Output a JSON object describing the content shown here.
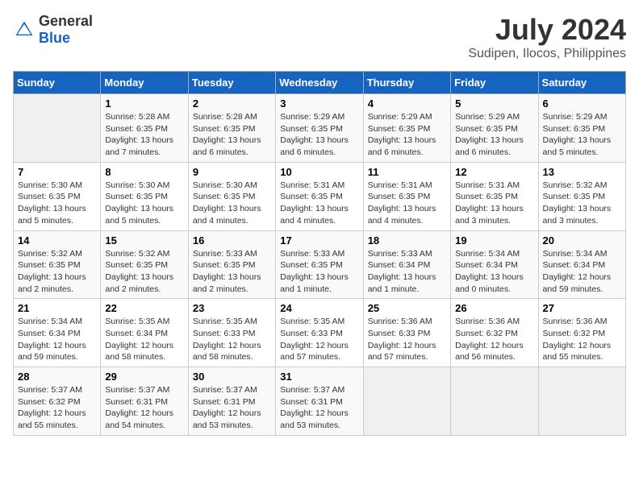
{
  "header": {
    "logo_general": "General",
    "logo_blue": "Blue",
    "title": "July 2024",
    "location": "Sudipen, Ilocos, Philippines"
  },
  "days_of_week": [
    "Sunday",
    "Monday",
    "Tuesday",
    "Wednesday",
    "Thursday",
    "Friday",
    "Saturday"
  ],
  "weeks": [
    [
      {
        "day": "",
        "info": ""
      },
      {
        "day": "1",
        "info": "Sunrise: 5:28 AM\nSunset: 6:35 PM\nDaylight: 13 hours\nand 7 minutes."
      },
      {
        "day": "2",
        "info": "Sunrise: 5:28 AM\nSunset: 6:35 PM\nDaylight: 13 hours\nand 6 minutes."
      },
      {
        "day": "3",
        "info": "Sunrise: 5:29 AM\nSunset: 6:35 PM\nDaylight: 13 hours\nand 6 minutes."
      },
      {
        "day": "4",
        "info": "Sunrise: 5:29 AM\nSunset: 6:35 PM\nDaylight: 13 hours\nand 6 minutes."
      },
      {
        "day": "5",
        "info": "Sunrise: 5:29 AM\nSunset: 6:35 PM\nDaylight: 13 hours\nand 6 minutes."
      },
      {
        "day": "6",
        "info": "Sunrise: 5:29 AM\nSunset: 6:35 PM\nDaylight: 13 hours\nand 5 minutes."
      }
    ],
    [
      {
        "day": "7",
        "info": "Sunrise: 5:30 AM\nSunset: 6:35 PM\nDaylight: 13 hours\nand 5 minutes."
      },
      {
        "day": "8",
        "info": "Sunrise: 5:30 AM\nSunset: 6:35 PM\nDaylight: 13 hours\nand 5 minutes."
      },
      {
        "day": "9",
        "info": "Sunrise: 5:30 AM\nSunset: 6:35 PM\nDaylight: 13 hours\nand 4 minutes."
      },
      {
        "day": "10",
        "info": "Sunrise: 5:31 AM\nSunset: 6:35 PM\nDaylight: 13 hours\nand 4 minutes."
      },
      {
        "day": "11",
        "info": "Sunrise: 5:31 AM\nSunset: 6:35 PM\nDaylight: 13 hours\nand 4 minutes."
      },
      {
        "day": "12",
        "info": "Sunrise: 5:31 AM\nSunset: 6:35 PM\nDaylight: 13 hours\nand 3 minutes."
      },
      {
        "day": "13",
        "info": "Sunrise: 5:32 AM\nSunset: 6:35 PM\nDaylight: 13 hours\nand 3 minutes."
      }
    ],
    [
      {
        "day": "14",
        "info": "Sunrise: 5:32 AM\nSunset: 6:35 PM\nDaylight: 13 hours\nand 2 minutes."
      },
      {
        "day": "15",
        "info": "Sunrise: 5:32 AM\nSunset: 6:35 PM\nDaylight: 13 hours\nand 2 minutes."
      },
      {
        "day": "16",
        "info": "Sunrise: 5:33 AM\nSunset: 6:35 PM\nDaylight: 13 hours\nand 2 minutes."
      },
      {
        "day": "17",
        "info": "Sunrise: 5:33 AM\nSunset: 6:35 PM\nDaylight: 13 hours\nand 1 minute."
      },
      {
        "day": "18",
        "info": "Sunrise: 5:33 AM\nSunset: 6:34 PM\nDaylight: 13 hours\nand 1 minute."
      },
      {
        "day": "19",
        "info": "Sunrise: 5:34 AM\nSunset: 6:34 PM\nDaylight: 13 hours\nand 0 minutes."
      },
      {
        "day": "20",
        "info": "Sunrise: 5:34 AM\nSunset: 6:34 PM\nDaylight: 12 hours\nand 59 minutes."
      }
    ],
    [
      {
        "day": "21",
        "info": "Sunrise: 5:34 AM\nSunset: 6:34 PM\nDaylight: 12 hours\nand 59 minutes."
      },
      {
        "day": "22",
        "info": "Sunrise: 5:35 AM\nSunset: 6:34 PM\nDaylight: 12 hours\nand 58 minutes."
      },
      {
        "day": "23",
        "info": "Sunrise: 5:35 AM\nSunset: 6:33 PM\nDaylight: 12 hours\nand 58 minutes."
      },
      {
        "day": "24",
        "info": "Sunrise: 5:35 AM\nSunset: 6:33 PM\nDaylight: 12 hours\nand 57 minutes."
      },
      {
        "day": "25",
        "info": "Sunrise: 5:36 AM\nSunset: 6:33 PM\nDaylight: 12 hours\nand 57 minutes."
      },
      {
        "day": "26",
        "info": "Sunrise: 5:36 AM\nSunset: 6:32 PM\nDaylight: 12 hours\nand 56 minutes."
      },
      {
        "day": "27",
        "info": "Sunrise: 5:36 AM\nSunset: 6:32 PM\nDaylight: 12 hours\nand 55 minutes."
      }
    ],
    [
      {
        "day": "28",
        "info": "Sunrise: 5:37 AM\nSunset: 6:32 PM\nDaylight: 12 hours\nand 55 minutes."
      },
      {
        "day": "29",
        "info": "Sunrise: 5:37 AM\nSunset: 6:31 PM\nDaylight: 12 hours\nand 54 minutes."
      },
      {
        "day": "30",
        "info": "Sunrise: 5:37 AM\nSunset: 6:31 PM\nDaylight: 12 hours\nand 53 minutes."
      },
      {
        "day": "31",
        "info": "Sunrise: 5:37 AM\nSunset: 6:31 PM\nDaylight: 12 hours\nand 53 minutes."
      },
      {
        "day": "",
        "info": ""
      },
      {
        "day": "",
        "info": ""
      },
      {
        "day": "",
        "info": ""
      }
    ]
  ]
}
